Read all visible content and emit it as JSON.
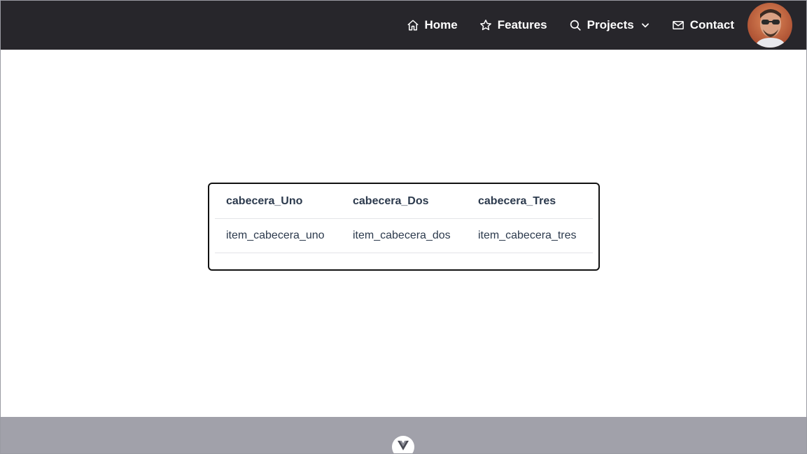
{
  "nav": {
    "items": [
      {
        "label": "Home",
        "icon": "home-icon"
      },
      {
        "label": "Features",
        "icon": "star-icon"
      },
      {
        "label": "Projects",
        "icon": "search-icon",
        "has_dropdown": true
      },
      {
        "label": "Contact",
        "icon": "mail-icon"
      }
    ],
    "avatar": "user-avatar"
  },
  "table": {
    "headers": [
      "cabecera_Uno",
      "cabecera_Dos",
      "cabecera_Tres"
    ],
    "rows": [
      [
        "item_cabecera_uno",
        "item_cabecera_dos",
        "item_cabecera_tres"
      ]
    ]
  },
  "footer": {
    "logo": "vue-logo-icon"
  },
  "colors": {
    "navbar_bg": "#27262b",
    "footer_bg": "#a1a1aa",
    "table_text": "#2c3a4d",
    "card_border": "#111111"
  }
}
